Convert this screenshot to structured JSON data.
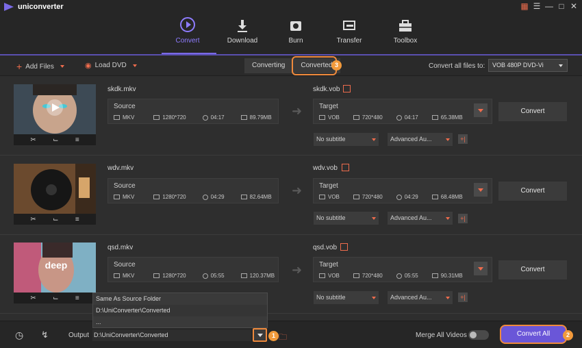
{
  "app": {
    "name": "uniconverter"
  },
  "nav": {
    "tabs": [
      {
        "label": "Convert",
        "icon": "convert-icon",
        "active": true
      },
      {
        "label": "Download",
        "icon": "download-icon"
      },
      {
        "label": "Burn",
        "icon": "burn-icon"
      },
      {
        "label": "Transfer",
        "icon": "transfer-icon"
      },
      {
        "label": "Toolbox",
        "icon": "toolbox-icon"
      }
    ]
  },
  "toolbar": {
    "add_files": "Add Files",
    "load_dvd": "Load DVD",
    "converting": "Converting",
    "converted": "Converted",
    "converted_badge": "3",
    "convert_all_to_label": "Convert all files to:",
    "format": "VOB 480P DVD-Vi"
  },
  "files": [
    {
      "source_name": "skdk.mkv",
      "target_name": "skdk.vob",
      "source": {
        "label": "Source",
        "format": "MKV",
        "resolution": "1280*720",
        "duration": "04:17",
        "size": "89.79MB"
      },
      "target": {
        "label": "Target",
        "format": "VOB",
        "resolution": "720*480",
        "duration": "04:17",
        "size": "65.38MB"
      },
      "subtitle": "No subtitle",
      "audio": "Advanced Au...",
      "convert_label": "Convert"
    },
    {
      "source_name": "wdv.mkv",
      "target_name": "wdv.vob",
      "source": {
        "label": "Source",
        "format": "MKV",
        "resolution": "1280*720",
        "duration": "04:29",
        "size": "82.64MB"
      },
      "target": {
        "label": "Target",
        "format": "VOB",
        "resolution": "720*480",
        "duration": "04:29",
        "size": "68.48MB"
      },
      "subtitle": "No subtitle",
      "audio": "Advanced Au...",
      "convert_label": "Convert"
    },
    {
      "source_name": "qsd.mkv",
      "target_name": "qsd.vob",
      "source": {
        "label": "Source",
        "format": "MKV",
        "resolution": "1280*720",
        "duration": "05:55",
        "size": "120.37MB"
      },
      "target": {
        "label": "Target",
        "format": "VOB",
        "resolution": "720*480",
        "duration": "05:55",
        "size": "90.31MB"
      },
      "subtitle": "No subtitle",
      "audio": "Advanced Au...",
      "convert_label": "Convert"
    }
  ],
  "output": {
    "label": "Output",
    "path": "D:\\UniConverter\\Converted",
    "badge": "1",
    "options": [
      "Same As Source Folder",
      "D:\\UniConverter\\Converted",
      "..."
    ]
  },
  "bottom": {
    "merge_label": "Merge All Videos",
    "merge_on": false,
    "convert_all": "Convert All",
    "convert_all_badge": "2"
  },
  "colors": {
    "accent": "#7a6ae6",
    "highlight": "#f08a3c",
    "icon_accent": "#ee6c4d"
  }
}
